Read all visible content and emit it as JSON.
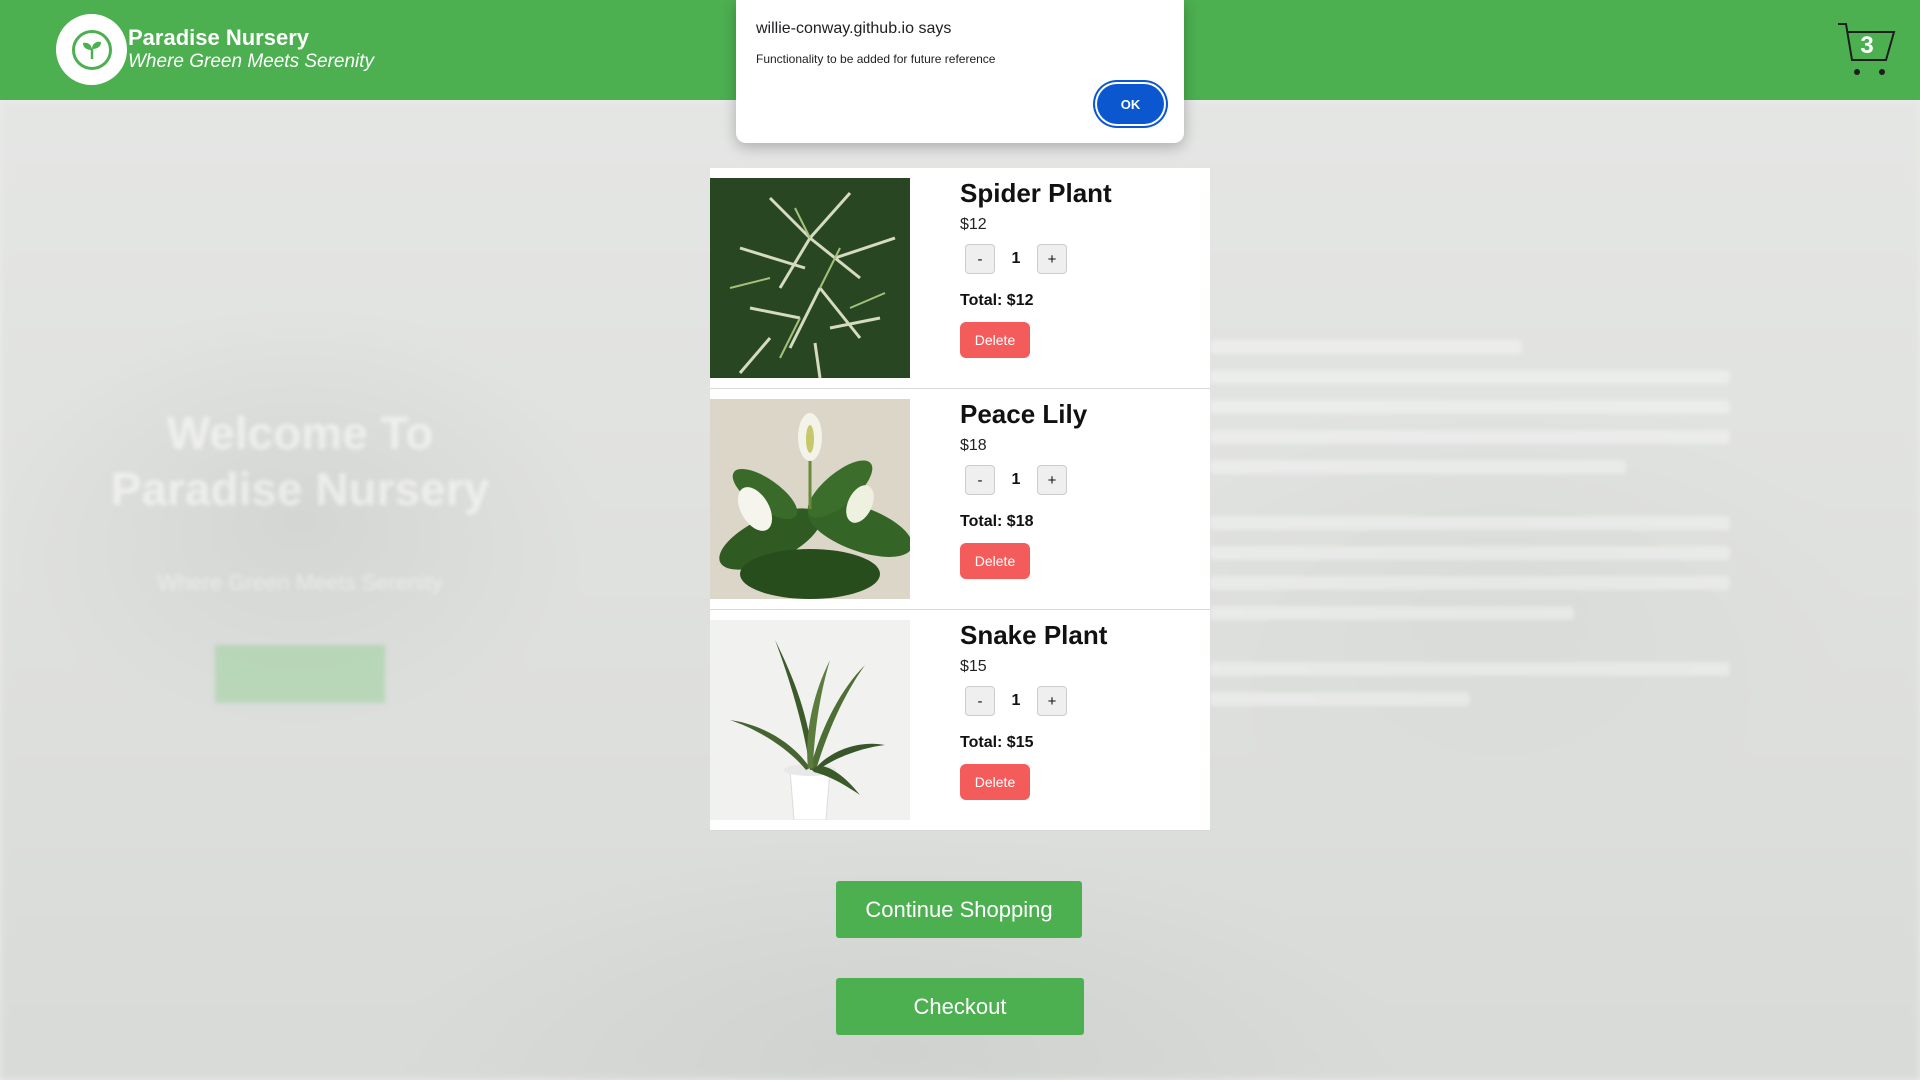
{
  "header": {
    "brand_name": "Paradise Nursery",
    "tagline": "Where Green Meets Serenity",
    "cart_count": "3",
    "color": "#4caf50"
  },
  "backdrop": {
    "title": "Welcome To Paradise Nursery",
    "tagline": "Where Green Meets Serenity"
  },
  "cart": {
    "items": [
      {
        "name": "Spider Plant",
        "price": "$12",
        "quantity": "1",
        "total": "Total: $12",
        "decrement": "-",
        "increment": "+",
        "delete_label": "Delete"
      },
      {
        "name": "Peace Lily",
        "price": "$18",
        "quantity": "1",
        "total": "Total: $18",
        "decrement": "-",
        "increment": "+",
        "delete_label": "Delete"
      },
      {
        "name": "Snake Plant",
        "price": "$15",
        "quantity": "1",
        "total": "Total: $15",
        "decrement": "-",
        "increment": "+",
        "delete_label": "Delete"
      }
    ],
    "continue_label": "Continue Shopping",
    "checkout_label": "Checkout"
  },
  "alert": {
    "title": "willie-conway.github.io says",
    "message": "Functionality to be added for future reference",
    "ok_label": "OK"
  }
}
